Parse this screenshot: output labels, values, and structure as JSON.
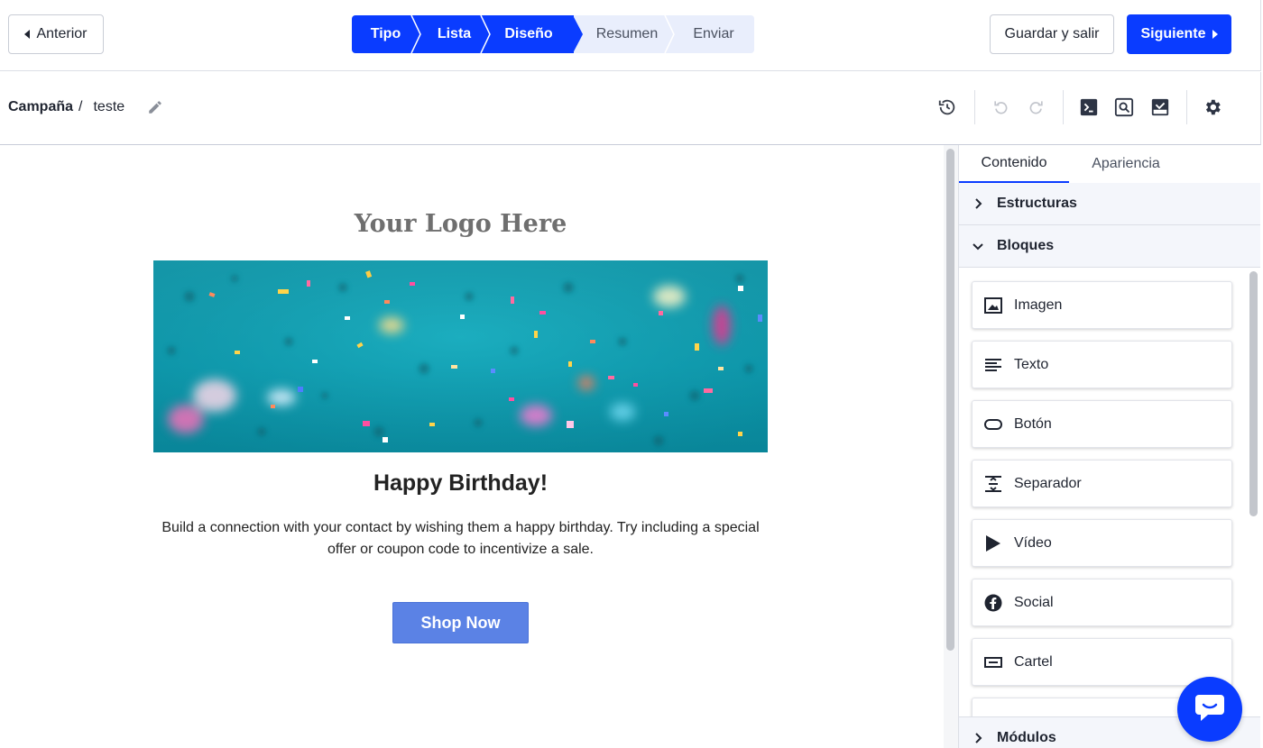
{
  "topbar": {
    "back_label": "Anterior",
    "steps": [
      {
        "label": "Tipo",
        "state": "done"
      },
      {
        "label": "Lista",
        "state": "done"
      },
      {
        "label": "Diseño",
        "state": "done"
      },
      {
        "label": "Resumen",
        "state": "todo"
      },
      {
        "label": "Enviar",
        "state": "todo"
      }
    ],
    "save_label": "Guardar y salir",
    "next_label": "Siguiente"
  },
  "breadcrumb": {
    "root": "Campaña",
    "separator": "/",
    "name": "teste"
  },
  "toolbar": {
    "icons": [
      "history-icon",
      "undo-icon",
      "redo-icon",
      "code-icon",
      "preview-icon",
      "test-email-icon",
      "settings-gear-icon"
    ]
  },
  "email": {
    "logo": "Your Logo Here",
    "title": "Happy Birthday!",
    "body": "Build a connection with your contact by wishing them a happy birthday. Try including a special offer or coupon code to incentivize a sale.",
    "button": "Shop Now"
  },
  "panel": {
    "tabs": [
      "Contenido",
      "Apariencia"
    ],
    "active_tab": "Contenido",
    "sections": {
      "structures": "Estructuras",
      "blocks": "Bloques",
      "modules": "Módulos"
    },
    "blocks": [
      {
        "label": "Imagen",
        "icon": "image-icon"
      },
      {
        "label": "Texto",
        "icon": "text-icon"
      },
      {
        "label": "Botón",
        "icon": "button-icon"
      },
      {
        "label": "Separador",
        "icon": "divider-icon"
      },
      {
        "label": "Vídeo",
        "icon": "video-icon"
      },
      {
        "label": "Social",
        "icon": "facebook-icon"
      },
      {
        "label": "Cartel",
        "icon": "banner-icon"
      }
    ]
  },
  "colors": {
    "brand": "#0a3cff",
    "email_button": "#5b82e5",
    "hero_teal": "#0fa2b7"
  }
}
